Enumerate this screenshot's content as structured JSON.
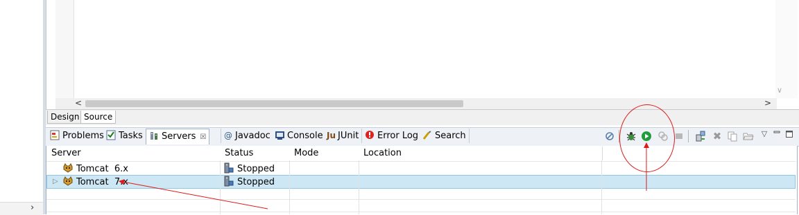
{
  "left_panel": {
    "expand_glyph": "›"
  },
  "editor": {
    "scroll_left": "<",
    "scroll_right": ">",
    "scroll_down": "∨",
    "tabs": [
      {
        "label": "Design"
      },
      {
        "label": "Source"
      }
    ],
    "active_tab": "Source"
  },
  "views": {
    "tabs": [
      {
        "label": "Problems",
        "icon": "problems-icon"
      },
      {
        "label": "Tasks",
        "icon": "tasks-icon"
      },
      {
        "label": "Servers",
        "icon": "servers-icon",
        "active": true,
        "close": "☒"
      },
      {
        "label": "Javadoc",
        "icon": "at-sign-icon",
        "glyph": "@"
      },
      {
        "label": "Console",
        "icon": "console-icon"
      },
      {
        "label": "JUnit",
        "icon": "junit-icon",
        "glyph": "Ju"
      },
      {
        "label": "Error Log",
        "icon": "error-log-icon"
      },
      {
        "label": "Search",
        "icon": "search-icon"
      }
    ]
  },
  "toolbar": {
    "icons": [
      "collapse-icon",
      "debug-server-icon",
      "start-server-icon",
      "profile-server-icon",
      "stop-server-icon",
      "publish-icon",
      "delete-icon",
      "copy-icon",
      "open-folder-icon",
      "view-menu-icon",
      "minimize-icon",
      "maximize-icon"
    ]
  },
  "servers": {
    "columns": [
      "Server",
      "Status",
      "Mode",
      "Location"
    ],
    "rows": [
      {
        "server": "Tomcat  6.x",
        "status": "Stopped",
        "mode": "",
        "location": "",
        "selected": false,
        "expand": ""
      },
      {
        "server": "Tomcat  7.x",
        "status": "Stopped",
        "mode": "",
        "location": "",
        "selected": true,
        "expand": "▷"
      }
    ]
  },
  "colors": {
    "annotation": "#e01818",
    "selection": "#cde8f4",
    "start_green": "#1f9d3a",
    "tab_strip": "#eef2f7"
  }
}
